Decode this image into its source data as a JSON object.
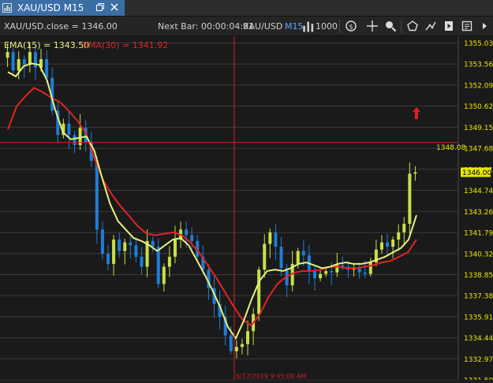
{
  "window": {
    "title": "XAU/USD M15"
  },
  "toolbar": {
    "series_label": "XAU/USD.close = 1346.00",
    "next_bar_label": "Next Bar: 00:00:04:01",
    "symbol": "XAU/USD",
    "timeframe": "M15",
    "bar_count": "1000"
  },
  "indicators": {
    "ema15_label": "EMA(15) = 1343.50",
    "ema30_label": "EMA(30) = 1341.92"
  },
  "colors": {
    "bull_candle": "#c8e04a",
    "bear_candle": "#1e7ed8",
    "ema15": "#e8f07a",
    "ema30": "#e02424",
    "crosshair": "#d02020",
    "axis_text": "#e8e800",
    "price_tag": "#e8e800"
  },
  "crosshair": {
    "price_label": "1348.08",
    "time_label": "6/17/2019 9:45:00 AM"
  },
  "current_price_label": "1346.00",
  "chart_data": {
    "type": "candlestick",
    "symbol": "XAU/USD",
    "timeframe": "M15",
    "y_ticks": [
      "1355.03",
      "1353.56",
      "1352.09",
      "1350.62",
      "1349.15",
      "1347.68",
      "1346.21",
      "1344.74",
      "1343.26",
      "1341.79",
      "1340.32",
      "1338.85",
      "1337.38",
      "1335.91",
      "1334.44",
      "1332.97",
      "1331.50"
    ],
    "ylim": [
      1331.5,
      1355.5
    ],
    "close_series": [
      1354.4,
      1353.1,
      1353.9,
      1353.5,
      1354.4,
      1353.3,
      1353.9,
      1352.6,
      1350.3,
      1348.6,
      1349.4,
      1348.6,
      1347.9,
      1349.1,
      1348.1,
      1346.8,
      1342.0,
      1340.3,
      1339.6,
      1341.3,
      1340.5,
      1341.1,
      1340.9,
      1340.1,
      1339.4,
      1341.2,
      1340.8,
      1338.2,
      1339.4,
      1340.1,
      1341.3,
      1342.0,
      1341.6,
      1341.2,
      1340.1,
      1339.2,
      1337.9,
      1336.8,
      1335.9,
      1334.6,
      1333.5,
      1333.8,
      1334.0,
      1334.9,
      1336.1,
      1339.2,
      1341.0,
      1341.8,
      1340.8,
      1339.3,
      1338.1,
      1339.6,
      1340.5,
      1340.2,
      1339.1,
      1338.6,
      1338.9,
      1339.1,
      1339.0,
      1339.5,
      1339.4,
      1339.2,
      1339.3,
      1339.0,
      1338.9,
      1339.7,
      1340.6,
      1341.1,
      1340.8,
      1341.3,
      1341.8,
      1342.4,
      1345.9,
      1346.0
    ],
    "ema15_series": [
      1353.0,
      1352.7,
      1353.4,
      1353.6,
      1353.5,
      1352.4,
      1350.4,
      1348.8,
      1348.3,
      1348.4,
      1348.5,
      1347.5,
      1345.6,
      1343.8,
      1342.6,
      1342.0,
      1341.4,
      1341.2,
      1340.9,
      1340.5,
      1340.9,
      1341.3,
      1341.4,
      1340.9,
      1339.9,
      1338.9,
      1337.8,
      1336.6,
      1335.2,
      1334.4,
      1335.6,
      1337.1,
      1338.4,
      1339.1,
      1339.2,
      1339.1,
      1339.3,
      1339.6,
      1339.7,
      1339.5,
      1339.3,
      1339.4,
      1339.6,
      1339.7,
      1339.6,
      1339.6,
      1339.7,
      1339.9,
      1340.1,
      1340.4,
      1340.7,
      1341.3,
      1343.0
    ],
    "ema30_series": [
      1349.0,
      1350.6,
      1351.3,
      1351.9,
      1351.6,
      1351.2,
      1350.9,
      1350.3,
      1349.6,
      1348.7,
      1346.9,
      1345.4,
      1344.4,
      1343.6,
      1342.9,
      1342.2,
      1341.7,
      1341.6,
      1341.7,
      1341.8,
      1341.6,
      1341.1,
      1340.4,
      1339.5,
      1338.6,
      1337.6,
      1336.6,
      1335.7,
      1335.3,
      1336.1,
      1337.3,
      1338.2,
      1338.7,
      1339.0,
      1339.1,
      1339.1,
      1339.2,
      1339.4,
      1339.4,
      1339.3,
      1339.3,
      1339.4,
      1339.5,
      1339.7,
      1339.8,
      1340.1,
      1340.4,
      1341.3
    ]
  }
}
